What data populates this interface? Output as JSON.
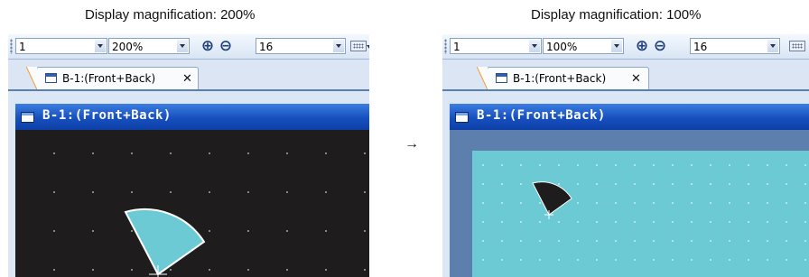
{
  "captions": {
    "left": "Display magnification: 200%",
    "right": "Display magnification: 100%",
    "arrow": "→"
  },
  "left_panel": {
    "toolbar": {
      "layer_value": "1",
      "zoom_value": "200%",
      "zoom_in_icon": "zoom-in-icon",
      "zoom_out_icon": "zoom-out-icon",
      "grid_value": "16",
      "keyboard_icon": "keyboard-icon"
    },
    "tab": {
      "label": "B-1:(Front+Back)",
      "close": "✕"
    },
    "window_title": "B-1:(Front+Back)",
    "colors": {
      "canvas": "#1e1c1d",
      "shape_fill": "#6ccad5",
      "shape_stroke": "#ffffff",
      "grid_dot": "#cfd2d6"
    }
  },
  "right_panel": {
    "toolbar": {
      "layer_value": "1",
      "zoom_value": "100%",
      "zoom_in_icon": "zoom-in-icon",
      "zoom_out_icon": "zoom-out-icon",
      "grid_value": "16",
      "keyboard_icon": "keyboard-icon"
    },
    "tab": {
      "label": "B-1:(Front+Back)",
      "close": "✕"
    },
    "window_title": "B-1:(Front+Back)",
    "colors": {
      "screen": "#6ccad5",
      "shape_fill": "#1e1c1d",
      "shape_stroke": "#ffffff",
      "grid_dot": "#e9f6f8"
    }
  }
}
